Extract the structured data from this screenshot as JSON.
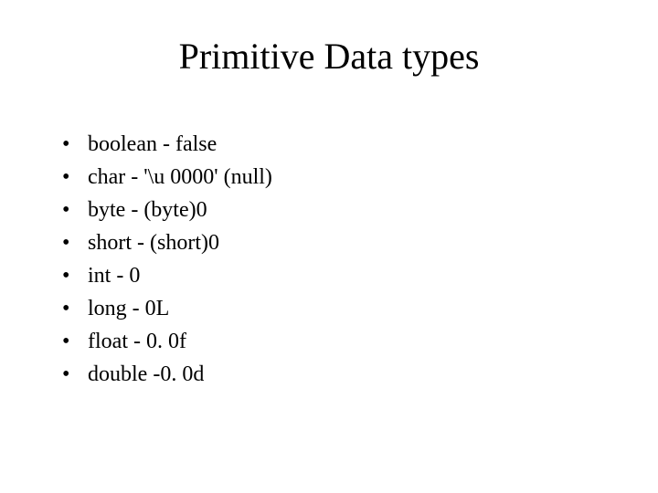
{
  "title": "Primitive Data types",
  "items": [
    "boolean    - false",
    "char - '\\u 0000' (null)",
    "byte - (byte)0",
    "short - (short)0",
    "int - 0",
    "long - 0L",
    "float - 0. 0f",
    "double -0. 0d"
  ],
  "bullet": "•"
}
